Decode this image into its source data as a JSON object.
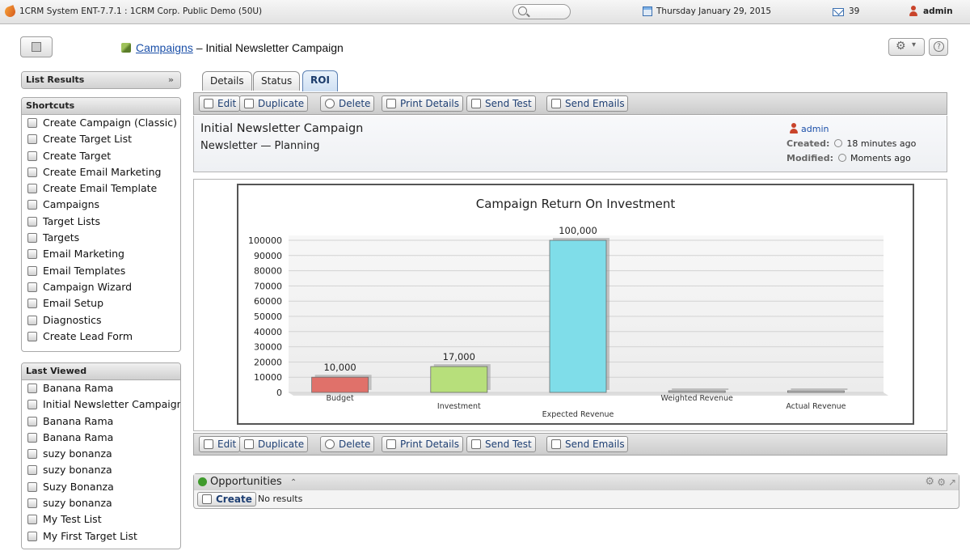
{
  "topbar": {
    "app_title": "1CRM System ENT-7.7.1 : 1CRM Corp. Public Demo (50U)",
    "date": "Thursday January 29, 2015",
    "mail_count": "39",
    "user": "admin"
  },
  "header": {
    "module_link": "Campaigns",
    "separator": " – ",
    "record_title": "Initial Newsletter Campaign"
  },
  "sidebar": {
    "list_results": "List Results",
    "shortcuts_title": "Shortcuts",
    "shortcuts": [
      {
        "label": "Create Campaign (Classic)"
      },
      {
        "label": "Create Target List"
      },
      {
        "label": "Create Target"
      },
      {
        "label": "Create Email Marketing"
      },
      {
        "label": "Create Email Template"
      },
      {
        "label": "Campaigns"
      },
      {
        "label": "Target Lists"
      },
      {
        "label": "Targets"
      },
      {
        "label": "Email Marketing"
      },
      {
        "label": "Email Templates"
      },
      {
        "label": "Campaign Wizard"
      },
      {
        "label": "Email Setup"
      },
      {
        "label": "Diagnostics"
      },
      {
        "label": "Create Lead Form"
      }
    ],
    "last_viewed_title": "Last Viewed",
    "last_viewed": [
      {
        "label": "Banana Rama"
      },
      {
        "label": "Initial Newsletter Campaign"
      },
      {
        "label": "Banana Rama"
      },
      {
        "label": "Banana Rama"
      },
      {
        "label": "suzy bonanza"
      },
      {
        "label": "suzy bonanza"
      },
      {
        "label": "Suzy Bonanza"
      },
      {
        "label": "suzy bonanza"
      },
      {
        "label": "My Test List"
      },
      {
        "label": "My First Target List"
      }
    ]
  },
  "tabs": [
    "Details",
    "Status",
    "ROI"
  ],
  "actions": {
    "edit": "Edit",
    "duplicate": "Duplicate",
    "delete": "Delete",
    "print": "Print Details",
    "send_test": "Send Test",
    "send_emails": "Send Emails"
  },
  "record": {
    "name": "Initial Newsletter Campaign",
    "subtitle": "Newsletter — Planning",
    "assigned_user": "admin",
    "created_label": "Created:",
    "created_value": "18 minutes ago",
    "modified_label": "Modified:",
    "modified_value": "Moments ago"
  },
  "chart_data": {
    "type": "bar",
    "title": "Campaign Return On Investment",
    "categories": [
      "Budget",
      "Investment",
      "Expected Revenue",
      "Weighted Revenue",
      "Actual Revenue"
    ],
    "values": [
      10000,
      17000,
      100000,
      0,
      0
    ],
    "value_labels": [
      "10,000",
      "17,000",
      "100,000",
      "",
      ""
    ],
    "colors": [
      "#e0716a",
      "#b7df7b",
      "#7fdde9",
      "#bdbdbd",
      "#bdbdbd"
    ],
    "ylim": [
      0,
      100000
    ],
    "yticks": [
      "100000",
      "90000",
      "80000",
      "70000",
      "60000",
      "50000",
      "40000",
      "30000",
      "20000",
      "10000",
      "0"
    ],
    "grid": true,
    "xlabel": "",
    "ylabel": ""
  },
  "opportunities": {
    "title": "Opportunities",
    "create_label": "Create",
    "no_results": "No results"
  }
}
